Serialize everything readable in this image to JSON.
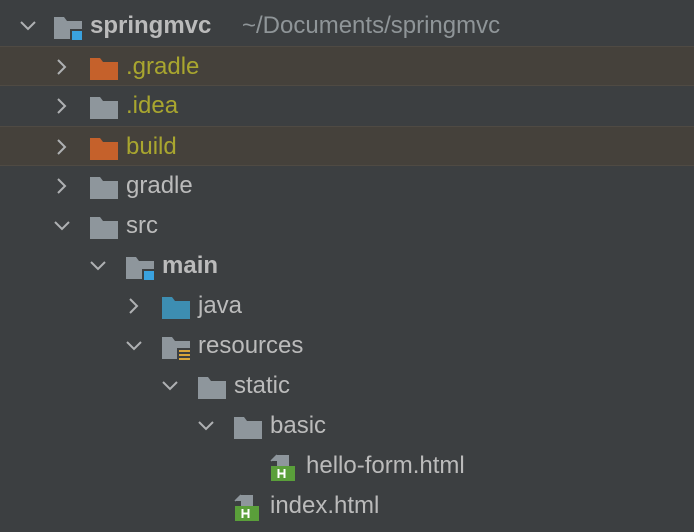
{
  "colors": {
    "background": "#3c3f41",
    "excluded_row": "#45413b",
    "text": "#bbbbbb",
    "excluded_text": "#a9a62f",
    "path_text": "#8f9598",
    "folder_gray": "#8e969c",
    "folder_orange": "#c5612b",
    "folder_blue": "#3d8eb2",
    "module_badge": "#3aa2df",
    "html_badge": "#5a9f3a"
  },
  "tree": {
    "root": {
      "label": "springmvc",
      "path": "~/Documents/springmvc",
      "icon": "module-folder-icon"
    },
    "nodes": [
      {
        "label": ".gradle",
        "icon": "excluded-folder-icon"
      },
      {
        "label": ".idea",
        "icon": "folder-icon"
      },
      {
        "label": "build",
        "icon": "excluded-folder-icon"
      },
      {
        "label": "gradle",
        "icon": "folder-icon"
      },
      {
        "label": "src",
        "icon": "folder-icon"
      },
      {
        "label": "main",
        "icon": "module-folder-icon"
      },
      {
        "label": "java",
        "icon": "source-folder-icon"
      },
      {
        "label": "resources",
        "icon": "resources-folder-icon"
      },
      {
        "label": "static",
        "icon": "folder-icon"
      },
      {
        "label": "basic",
        "icon": "folder-icon"
      },
      {
        "label": "hello-form.html",
        "icon": "html-file-icon"
      },
      {
        "label": "index.html",
        "icon": "html-file-icon"
      }
    ]
  }
}
